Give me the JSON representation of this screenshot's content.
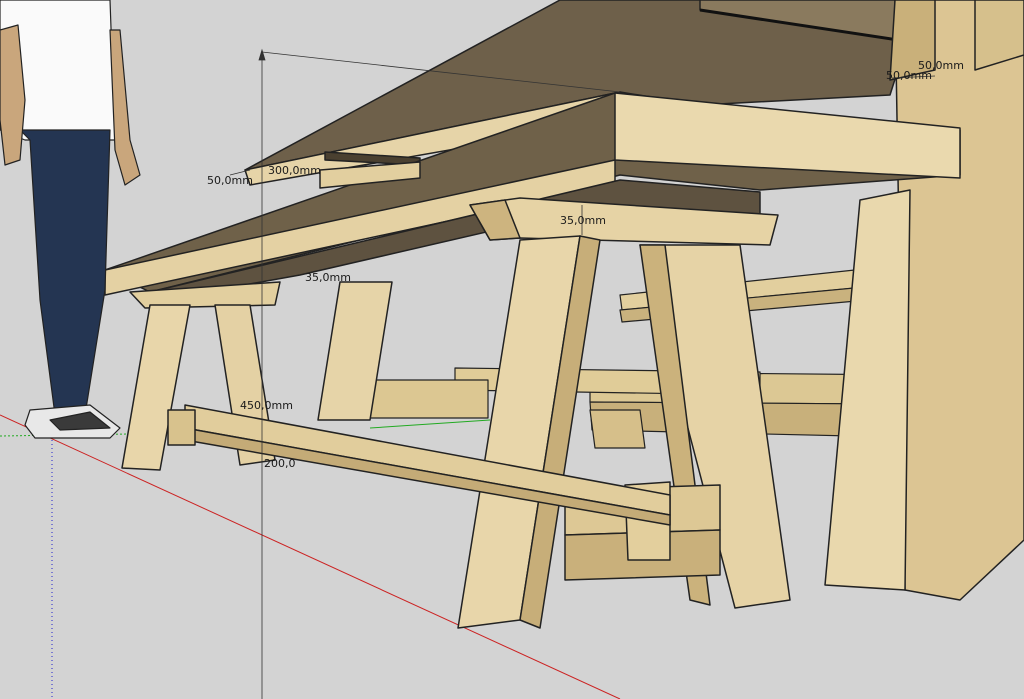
{
  "app": "SketchUp",
  "scene": {
    "subject": "picnic-table-with-benches",
    "material": "birch-plywood",
    "axes": {
      "red": "#cc2222",
      "green": "#22aa22",
      "blue": "#2222cc"
    },
    "colors": {
      "wood_light": "#e8d7ad",
      "wood_mid": "#d9c391",
      "wood_dark": "#b59d6a",
      "shadow_face": "#7a6a4e",
      "under_face": "#6a5c44",
      "background": "#d3d3d3"
    }
  },
  "dimensions": {
    "d1": "50,0mm",
    "d2": "300,0mm",
    "d3": "50,0mm",
    "d4": "50,0mm",
    "d5": "35,0mm",
    "d6": "35,0mm",
    "d7": "450,0mm",
    "d8": "200,0"
  }
}
